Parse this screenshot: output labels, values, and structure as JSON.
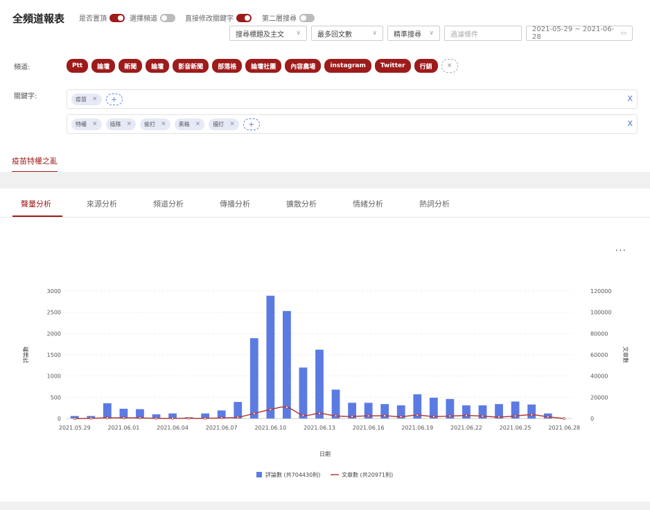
{
  "header": {
    "title": "全頻道報表",
    "toggles": [
      {
        "label": "是否置頂",
        "on": true
      },
      {
        "label": "選擇頻道",
        "on": false
      },
      {
        "label": "直接修改關鍵字",
        "on": true
      },
      {
        "label": "第二層搜尋",
        "on": false
      }
    ]
  },
  "filters": {
    "search_scope": "搜尋標題及主文",
    "sort": "最多回文數",
    "mode": "精準搜尋",
    "exclude_placeholder": "過濾條件",
    "date_range": "2021-05-29 ~ 2021-06-28"
  },
  "channels": {
    "label": "頻道:",
    "items": [
      "Ptt",
      "論壇",
      "新聞",
      "論壇",
      "影音新聞",
      "部落格",
      "論壇社團",
      "內容農場",
      "instagram",
      "Twitter",
      "行銷"
    ],
    "clear": "×"
  },
  "keywords": {
    "label": "關鍵字:",
    "row1": [
      "疫苗"
    ],
    "row2": [
      "特權",
      "插隊",
      "偷打",
      "黑箱",
      "擅打"
    ],
    "close": "X"
  },
  "topic_tab": "疫苗特權之亂",
  "analysis_tabs": [
    "聲量分析",
    "來源分析",
    "頻道分析",
    "傳播分析",
    "擴散分析",
    "情緒分析",
    "熱詞分析"
  ],
  "more_menu": "···",
  "colors": {
    "brand": "#9e1b1b",
    "bar": "#5b7be3",
    "line": "#b13a3a"
  },
  "chart_data": {
    "type": "bar",
    "xlabel": "日期",
    "ylabel_left": "評論數",
    "ylabel_right": "文章數",
    "x": [
      "2021.05.29",
      "2021.05.30",
      "2021.05.31",
      "2021.06.01",
      "2021.06.02",
      "2021.06.03",
      "2021.06.04",
      "2021.06.05",
      "2021.06.06",
      "2021.06.07",
      "2021.06.08",
      "2021.06.09",
      "2021.06.10",
      "2021.06.11",
      "2021.06.12",
      "2021.06.13",
      "2021.06.14",
      "2021.06.15",
      "2021.06.16",
      "2021.06.17",
      "2021.06.18",
      "2021.06.19",
      "2021.06.20",
      "2021.06.21",
      "2021.06.22",
      "2021.06.23",
      "2021.06.24",
      "2021.06.25",
      "2021.06.26",
      "2021.06.27",
      "2021.06.28"
    ],
    "tick_labels": [
      "2021.05.29",
      "2021.06.01",
      "2021.06.04",
      "2021.06.07",
      "2021.06.10",
      "2021.06.13",
      "2021.06.16",
      "2021.06.19",
      "2021.06.22",
      "2021.06.25",
      "2021.06.28"
    ],
    "left_ticks": [
      0,
      500,
      1000,
      1500,
      2000,
      2500,
      3000
    ],
    "right_ticks": [
      0,
      20000,
      40000,
      60000,
      80000,
      100000,
      120000
    ],
    "series": [
      {
        "name": "評論數 (共704430則)",
        "type": "bar",
        "values": [
          60,
          60,
          360,
          230,
          220,
          100,
          120,
          30,
          120,
          190,
          390,
          1890,
          2890,
          2530,
          1200,
          1620,
          680,
          370,
          370,
          340,
          310,
          570,
          490,
          460,
          310,
          310,
          340,
          400,
          330,
          120,
          0
        ]
      },
      {
        "name": "文章數 (共20971則)",
        "type": "line",
        "values": [
          0,
          180,
          620,
          600,
          610,
          200,
          150,
          260,
          150,
          540,
          1200,
          4800,
          8500,
          10700,
          3000,
          4800,
          2500,
          2000,
          2500,
          2600,
          1800,
          3200,
          1900,
          2400,
          2800,
          2300,
          1400,
          2400,
          3550,
          1600,
          0
        ]
      }
    ]
  }
}
